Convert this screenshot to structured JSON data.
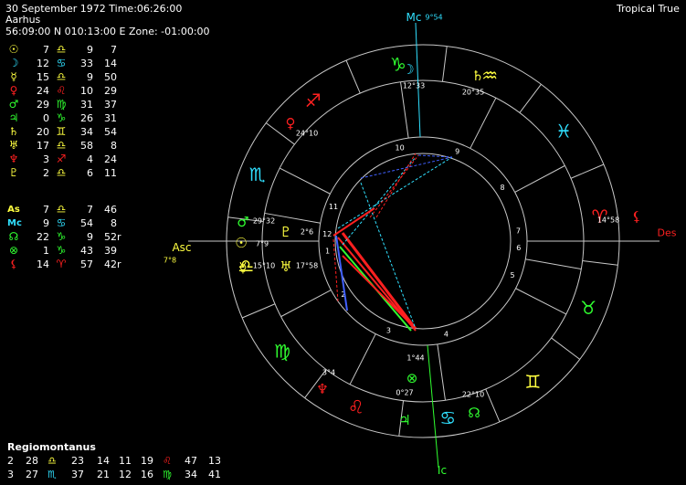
{
  "header": {
    "line1": "30 September 1972 Time:06:26:00",
    "line2": "Aarhus",
    "line3": "56:09:00 N 010:13:00 E Zone: -01:00:00",
    "zodiac_mode": "Tropical True"
  },
  "colors": {
    "background": "#000000",
    "text": "#ffffff",
    "fire": "#ff2020",
    "earth": "#30ff30",
    "air": "#ffff40",
    "water": "#30e0ff",
    "circle": "#c8c8c8"
  },
  "planets": [
    {
      "glyph": "☉",
      "icon": "sun-icon",
      "color": "#ffff40",
      "deg": "7",
      "sign": "♎",
      "sign_icon": "libra-icon",
      "sign_color": "#ffff40",
      "d": "9",
      "m": "7",
      "r": ""
    },
    {
      "glyph": "☽",
      "icon": "moon-icon",
      "color": "#30e0ff",
      "deg": "12",
      "sign": "♋",
      "sign_icon": "cancer-icon",
      "sign_color": "#30e0ff",
      "d": "33",
      "m": "14",
      "r": ""
    },
    {
      "glyph": "☿",
      "icon": "mercury-icon",
      "color": "#ffff40",
      "deg": "15",
      "sign": "♎",
      "sign_icon": "libra-icon",
      "sign_color": "#ffff40",
      "d": "9",
      "m": "50",
      "r": ""
    },
    {
      "glyph": "♀",
      "icon": "venus-icon",
      "color": "#ff2020",
      "deg": "24",
      "sign": "♌",
      "sign_icon": "leo-icon",
      "sign_color": "#ff2020",
      "d": "10",
      "m": "29",
      "r": ""
    },
    {
      "glyph": "♂",
      "icon": "mars-icon",
      "color": "#30ff30",
      "deg": "29",
      "sign": "♍",
      "sign_icon": "virgo-icon",
      "sign_color": "#30ff30",
      "d": "31",
      "m": "37",
      "r": ""
    },
    {
      "glyph": "♃",
      "icon": "jupiter-icon",
      "color": "#30ff30",
      "deg": "0",
      "sign": "♑",
      "sign_icon": "capricorn-icon",
      "sign_color": "#30ff30",
      "d": "26",
      "m": "31",
      "r": ""
    },
    {
      "glyph": "♄",
      "icon": "saturn-icon",
      "color": "#ffff40",
      "deg": "20",
      "sign": "♊",
      "sign_icon": "gemini-icon",
      "sign_color": "#ffff40",
      "d": "34",
      "m": "54",
      "r": ""
    },
    {
      "glyph": "♅",
      "icon": "uranus-icon",
      "color": "#ffff40",
      "deg": "17",
      "sign": "♎",
      "sign_icon": "libra-icon",
      "sign_color": "#ffff40",
      "d": "58",
      "m": "8",
      "r": ""
    },
    {
      "glyph": "♆",
      "icon": "neptune-icon",
      "color": "#ff2020",
      "deg": "3",
      "sign": "♐",
      "sign_icon": "sagittarius-icon",
      "sign_color": "#ff2020",
      "d": "4",
      "m": "24",
      "r": ""
    },
    {
      "glyph": "♇",
      "icon": "pluto-icon",
      "color": "#ffff40",
      "deg": "2",
      "sign": "♎",
      "sign_icon": "libra-icon",
      "sign_color": "#ffff40",
      "d": "6",
      "m": "11",
      "r": ""
    }
  ],
  "points": [
    {
      "glyph": "As",
      "icon": "ascendant-label",
      "color": "#ffff40",
      "deg": "7",
      "sign": "♎",
      "sign_icon": "libra-icon",
      "sign_color": "#ffff40",
      "d": "7",
      "m": "46",
      "r": ""
    },
    {
      "glyph": "Mc",
      "icon": "midheaven-label",
      "color": "#30e0ff",
      "deg": "9",
      "sign": "♋",
      "sign_icon": "cancer-icon",
      "sign_color": "#30e0ff",
      "d": "54",
      "m": "8",
      "r": ""
    },
    {
      "glyph": "☊",
      "icon": "north-node-icon",
      "color": "#30ff30",
      "deg": "22",
      "sign": "♑",
      "sign_icon": "capricorn-icon",
      "sign_color": "#30ff30",
      "d": "9",
      "m": "52",
      "r": "r"
    },
    {
      "glyph": "⊗",
      "icon": "part-of-fortune-icon",
      "color": "#30ff30",
      "deg": "1",
      "sign": "♑",
      "sign_icon": "capricorn-icon",
      "sign_color": "#30ff30",
      "d": "43",
      "m": "39",
      "r": ""
    },
    {
      "glyph": "⚸",
      "icon": "lilith-icon",
      "color": "#ff2020",
      "deg": "14",
      "sign": "♈",
      "sign_icon": "aries-icon",
      "sign_color": "#ff2020",
      "d": "57",
      "m": "42",
      "r": "r"
    }
  ],
  "house_system": "Regiomontanus",
  "houses": [
    {
      "n1": "2",
      "c1": "28",
      "s1": "♎",
      "sc1": "#ffff40",
      "i1": "libra-icon",
      "m1": "23",
      "n2": "14",
      "c2": "11",
      "n3": "19",
      "s3": "♌",
      "sc3": "#ff2020",
      "i3": "leo-icon",
      "m3": "47",
      "e3": "13"
    },
    {
      "n1": "3",
      "c1": "27",
      "s1": "♏",
      "sc1": "#30e0ff",
      "i1": "scorpio-icon",
      "m1": "37",
      "n2": "21",
      "c2": "12",
      "n3": "16",
      "s3": "♍",
      "sc3": "#30ff30",
      "i3": "virgo-icon",
      "m3": "34",
      "e3": "41"
    }
  ],
  "wheel": {
    "angle_labels": {
      "asc": "Asc",
      "des": "Des",
      "mc": "Mc",
      "ic": "Ic"
    },
    "asc_deg": "7",
    "asc_min": "8",
    "mc_deg": "9",
    "mc_min": "54",
    "signs": [
      {
        "glyph": "♎",
        "name": "libra-icon",
        "color": "#ffff40"
      },
      {
        "glyph": "♍",
        "name": "virgo-icon",
        "color": "#30ff30"
      },
      {
        "glyph": "♌",
        "name": "leo-icon",
        "color": "#ff2020"
      },
      {
        "glyph": "♋",
        "name": "cancer-icon",
        "color": "#30e0ff"
      },
      {
        "glyph": "♊",
        "name": "gemini-icon",
        "color": "#ffff40"
      },
      {
        "glyph": "♉",
        "name": "taurus-icon",
        "color": "#30ff30"
      },
      {
        "glyph": "♈",
        "name": "aries-icon",
        "color": "#ff2020"
      },
      {
        "glyph": "♓",
        "name": "pisces-icon",
        "color": "#30e0ff"
      },
      {
        "glyph": "♒",
        "name": "aquarius-icon",
        "color": "#ffff40"
      },
      {
        "glyph": "♑",
        "name": "capricorn-icon",
        "color": "#30ff30"
      },
      {
        "glyph": "♐",
        "name": "sagittarius-icon",
        "color": "#ff2020"
      },
      {
        "glyph": "♏",
        "name": "scorpio-icon",
        "color": "#30e0ff"
      }
    ],
    "house_numbers": [
      "1",
      "2",
      "3",
      "4",
      "5",
      "6",
      "7",
      "8",
      "9",
      "10",
      "11",
      "12"
    ],
    "chart_planets": [
      {
        "glyph": "♂",
        "name": "mars-icon",
        "color": "#30ff30",
        "deg": "29",
        "min": "32"
      },
      {
        "glyph": "♇",
        "name": "pluto-icon",
        "color": "#ffff40",
        "deg": "2",
        "min": "6"
      },
      {
        "glyph": "☉",
        "name": "sun-icon",
        "color": "#ffff40",
        "deg": "7",
        "min": "9"
      },
      {
        "glyph": "☿",
        "name": "mercury-icon",
        "color": "#ffff40",
        "deg": "15",
        "min": "10"
      },
      {
        "glyph": "♅",
        "name": "uranus-icon",
        "color": "#ffff40",
        "deg": "17",
        "min": "58"
      },
      {
        "glyph": "♀",
        "name": "venus-icon",
        "color": "#ff2020",
        "deg": "24",
        "min": "10"
      },
      {
        "glyph": "☽",
        "name": "moon-icon",
        "color": "#30e0ff",
        "deg": "12",
        "min": "33"
      },
      {
        "glyph": "♄",
        "name": "saturn-icon",
        "color": "#ffff40",
        "deg": "20",
        "min": "35"
      },
      {
        "glyph": "⚸",
        "name": "lilith-icon",
        "color": "#ff2020",
        "deg": "14",
        "min": "58"
      },
      {
        "glyph": "☊",
        "name": "north-node-icon",
        "color": "#30ff30",
        "deg": "22",
        "min": "10"
      },
      {
        "glyph": "♃",
        "name": "jupiter-icon",
        "color": "#30ff30",
        "deg": "0",
        "min": "27"
      },
      {
        "glyph": "⊗",
        "name": "part-of-fortune-icon",
        "color": "#30ff30",
        "deg": "1",
        "min": "44"
      },
      {
        "glyph": "♆",
        "name": "neptune-icon",
        "color": "#ff2020",
        "deg": "3",
        "min": "4"
      }
    ]
  }
}
